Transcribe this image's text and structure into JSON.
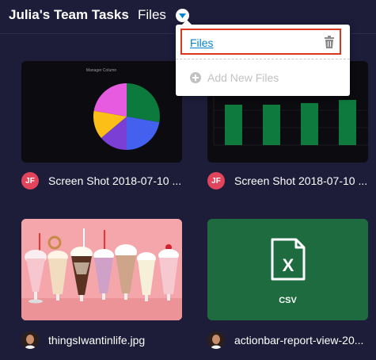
{
  "header": {
    "board_title": "Julia's Team Tasks",
    "view_name": "Files"
  },
  "dropdown": {
    "items": [
      {
        "label": "Files"
      }
    ],
    "add_label": "Add New Files"
  },
  "pie_chart": {
    "title": "Manager Column"
  },
  "files": [
    {
      "name": "Screen Shot 2018-07-10 ...",
      "uploader_initials": "JF"
    },
    {
      "name": "Screen Shot 2018-07-10 ...",
      "uploader_initials": "JF"
    },
    {
      "name": "thingsIwantinlife.jpg"
    },
    {
      "name": "actionbar-report-view-20...",
      "type_label": "CSV"
    }
  ],
  "colors": {
    "background": "#1d1d3a",
    "avatar_red": "#e2445c",
    "csv_green": "#1e6b3f",
    "link_blue": "#0085d1",
    "highlight_red": "#d9381e"
  }
}
